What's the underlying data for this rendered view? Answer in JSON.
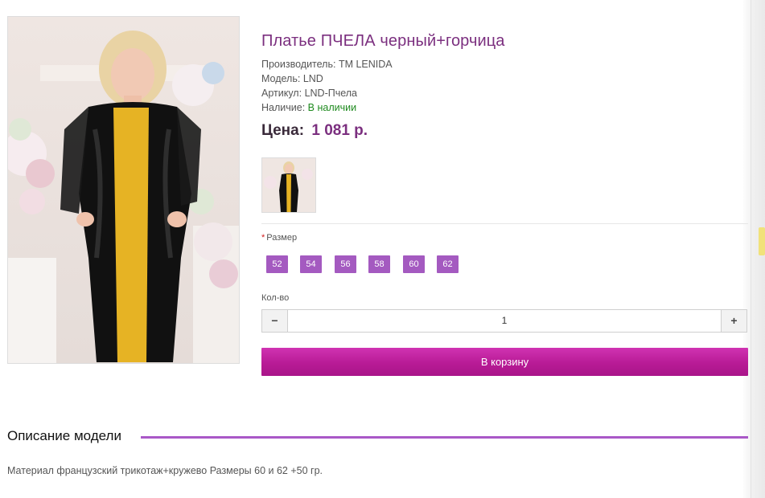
{
  "product": {
    "title": "Платье ПЧЕЛА черный+горчица",
    "manufacturer_label": "Производитель:",
    "manufacturer": "ТМ LENIDA",
    "model_label": "Модель:",
    "model": "LND",
    "sku_label": "Артикул:",
    "sku": "LND-Пчела",
    "availability_label": "Наличие:",
    "availability": "В наличии",
    "price_label": "Цена:",
    "price": "1 081 р."
  },
  "options": {
    "size_label": "Размер",
    "required_mark": "*",
    "sizes": [
      "52",
      "54",
      "56",
      "58",
      "60",
      "62"
    ]
  },
  "quantity": {
    "label": "Кол-во",
    "value": "1",
    "minus": "−",
    "plus": "+"
  },
  "cart": {
    "button_label": "В корзину"
  },
  "description": {
    "heading": "Описание модели",
    "text": "Материал французский трикотаж+кружево Размеры 60 и 62 +50 гр."
  },
  "colors": {
    "accent_purple": "#7b2f7f",
    "size_button": "#a45ac0",
    "cart_button": "#b81b96",
    "in_stock_green": "#1e8a1e",
    "dress_mustard": "#e6b324"
  }
}
